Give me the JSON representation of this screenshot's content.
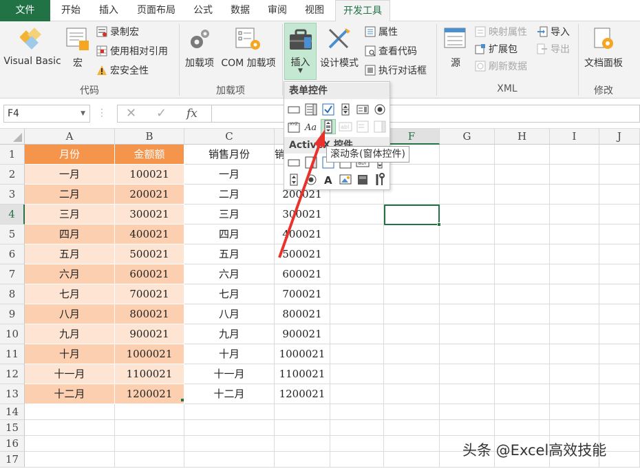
{
  "tabs": [
    {
      "label": "文件"
    },
    {
      "label": "开始"
    },
    {
      "label": "插入"
    },
    {
      "label": "页面布局"
    },
    {
      "label": "公式"
    },
    {
      "label": "数据"
    },
    {
      "label": "审阅"
    },
    {
      "label": "视图"
    },
    {
      "label": "开发工具"
    }
  ],
  "ribbon": {
    "code": {
      "group_label": "代码",
      "visual_basic": "Visual Basic",
      "macro": "宏",
      "record_macro": "录制宏",
      "relative_ref": "使用相对引用",
      "macro_security": "宏安全性"
    },
    "addins": {
      "group_label": "加载项",
      "addins": "加载项",
      "com_addins": "COM 加载项"
    },
    "controls": {
      "insert": "插入",
      "design_mode": "设计模式",
      "properties": "属性",
      "view_code": "查看代码",
      "run_dialog": "执行对话框"
    },
    "xml": {
      "group_label": "XML",
      "source": "源",
      "map_props": "映射属性",
      "expansion": "扩展包",
      "refresh": "刷新数据",
      "import": "导入",
      "export": "导出"
    },
    "modify": {
      "group_label": "修改",
      "doc_panel": "文档面板"
    }
  },
  "formula_bar": {
    "name_box": "F4",
    "fx": "fx",
    "cancel_icon": "close-icon",
    "enter_icon": "check-icon"
  },
  "grid": {
    "columns": [
      "A",
      "B",
      "C",
      "",
      "F",
      "G",
      "H",
      "I",
      "J"
    ],
    "rows": [
      "1",
      "2",
      "3",
      "4",
      "5",
      "6",
      "7",
      "8",
      "9",
      "10",
      "11",
      "12",
      "13",
      "14",
      "15",
      "16",
      "17"
    ],
    "header_row": [
      "月份",
      "金额额",
      "销售月份",
      "销"
    ],
    "data": [
      [
        "一月",
        "100021",
        "一月",
        ""
      ],
      [
        "二月",
        "200021",
        "二月",
        "200021"
      ],
      [
        "三月",
        "300021",
        "三月",
        "300021"
      ],
      [
        "四月",
        "400021",
        "四月",
        "400021"
      ],
      [
        "五月",
        "500021",
        "五月",
        "500021"
      ],
      [
        "六月",
        "600021",
        "六月",
        "600021"
      ],
      [
        "七月",
        "700021",
        "七月",
        "700021"
      ],
      [
        "八月",
        "800021",
        "八月",
        "800021"
      ],
      [
        "九月",
        "900021",
        "九月",
        "900021"
      ],
      [
        "十月",
        "1000021",
        "十月",
        "1000021"
      ],
      [
        "十一月",
        "1100021",
        "十一月",
        "1100021"
      ],
      [
        "十二月",
        "1200021",
        "十二月",
        "1200021"
      ]
    ]
  },
  "dropdown": {
    "form_controls_title": "表单控件",
    "activex_title": "ActiveX 控件",
    "tooltip": "滚动条(窗体控件)"
  },
  "watermark": "头条 @Excel高效技能",
  "colors": {
    "accent": "#217346",
    "header_fill": "#f4954b",
    "row_fill_light": "#fde4d3",
    "row_fill_dark": "#fbcfb0",
    "arrow": "#e8322b"
  }
}
